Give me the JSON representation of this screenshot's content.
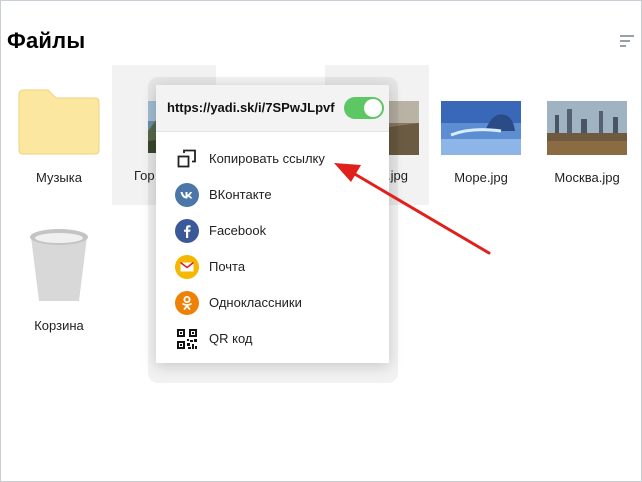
{
  "page": {
    "title": "Файлы"
  },
  "files": [
    {
      "name": "Музыка",
      "type": "folder"
    },
    {
      "name": "Гор",
      "type": "image"
    },
    {
      "name": ".jpg",
      "type": "image"
    },
    {
      "name": "Море.jpg",
      "type": "image"
    },
    {
      "name": "Москва.jpg",
      "type": "image"
    },
    {
      "name": "Корзина",
      "type": "trash"
    }
  ],
  "share_popup": {
    "link": "https://yadi.sk/i/7SPwJLpvf",
    "link_enabled": true,
    "items": [
      {
        "label": "Копировать ссылку",
        "icon": "copy-icon"
      },
      {
        "label": "ВКонтакте",
        "icon": "vk-icon",
        "color": "#4a76a8"
      },
      {
        "label": "Facebook",
        "icon": "facebook-icon",
        "color": "#3b5998"
      },
      {
        "label": "Почта",
        "icon": "mail-icon",
        "color": "#f5b800"
      },
      {
        "label": "Одноклассники",
        "icon": "ok-icon",
        "color": "#ee8208"
      },
      {
        "label": "QR код",
        "icon": "qr-icon"
      }
    ]
  },
  "colors": {
    "accent_arrow": "#e0201b",
    "toggle_on": "#5cc763"
  }
}
